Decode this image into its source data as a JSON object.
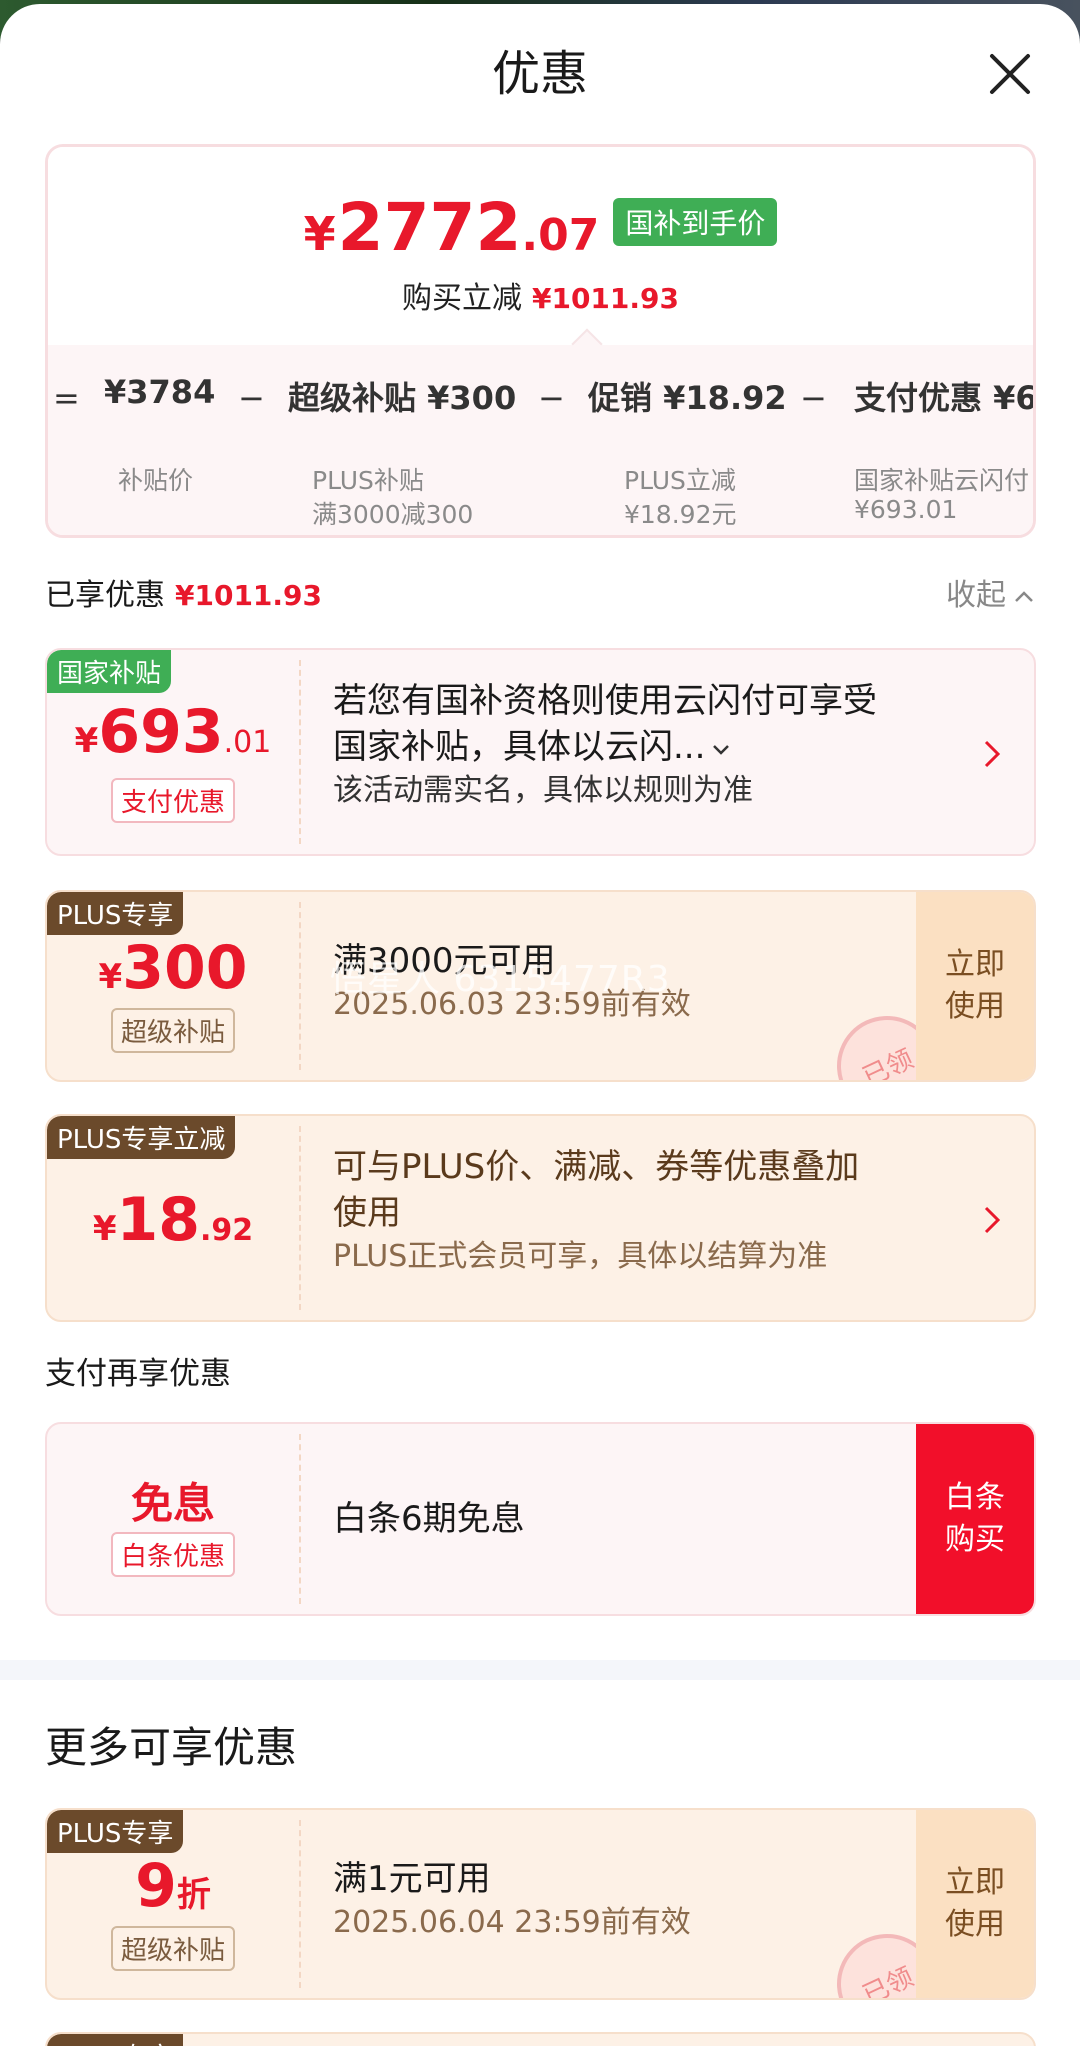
{
  "header": {
    "title": "优惠"
  },
  "summary": {
    "currency": "¥",
    "price_int": "2772",
    "price_dec": ".07",
    "price_tag": "国补到手价",
    "reduce_label": "购买立减",
    "reduce_amount": "¥1011.93",
    "formula": [
      {
        "op": "=",
        "term": "¥3784",
        "sub1": "补贴价",
        "sub2": ""
      },
      {
        "op": "−",
        "term": "超级补贴 ¥300",
        "sub1": "PLUS补贴",
        "sub2": "满3000减300"
      },
      {
        "op": "−",
        "term": "促销 ¥18.92",
        "sub1": "PLUS立减",
        "sub2": "¥18.92元"
      },
      {
        "op": "−",
        "term": "支付优惠 ¥6",
        "sub1": "国家补贴云闪付",
        "sub2": "¥693.01"
      }
    ]
  },
  "enjoyed": {
    "label": "已享优惠",
    "amount": "¥1011.93",
    "collapse": "收起"
  },
  "cards": {
    "gov": {
      "badge": "国家补贴",
      "currency": "¥",
      "int": "693",
      "dec": ".01",
      "tag": "支付优惠",
      "main_line1": "若您有国补资格则使用云闪付可享受",
      "main_line2": "国家补贴，具体以云闪...",
      "sub": "该活动需实名，具体以规则为准"
    },
    "plus1": {
      "badge": "PLUS专享",
      "currency": "¥",
      "int": "300",
      "tag": "超级补贴",
      "main": "满3000元可用",
      "sub": "2025.06.03 23:59前有效",
      "use_line1": "立即",
      "use_line2": "使用",
      "stamp": "已领"
    },
    "plus2": {
      "badge": "PLUS专享立减",
      "currency": "¥",
      "int": "18",
      "dec": ".92",
      "main_line1": "可与PLUS价、满减、券等优惠叠加",
      "main_line2": "使用",
      "sub": "PLUS正式会员可享，具体以结算为准"
    },
    "baitiao": {
      "free": "免息",
      "tag": "白条优惠",
      "main": "白条6期免息",
      "use_line1": "白条",
      "use_line2": "购买"
    },
    "plus3": {
      "badge": "PLUS专享",
      "int": "9",
      "unit": "折",
      "tag": "超级补贴",
      "main": "满1元可用",
      "sub": "2025.06.04 23:59前有效",
      "use_line1": "立即",
      "use_line2": "使用",
      "stamp": "已领"
    },
    "plus4": {
      "badge": "PLUS专享"
    }
  },
  "pay_heading": "支付再享优惠",
  "more_heading": "更多可享优惠",
  "watermark": "悟星人 6315477R3",
  "colors": {
    "accent_red": "#e8182b",
    "gov_green": "#3fae55",
    "plus_brown": "#6b4a2b",
    "button_red": "#f20f2a"
  }
}
